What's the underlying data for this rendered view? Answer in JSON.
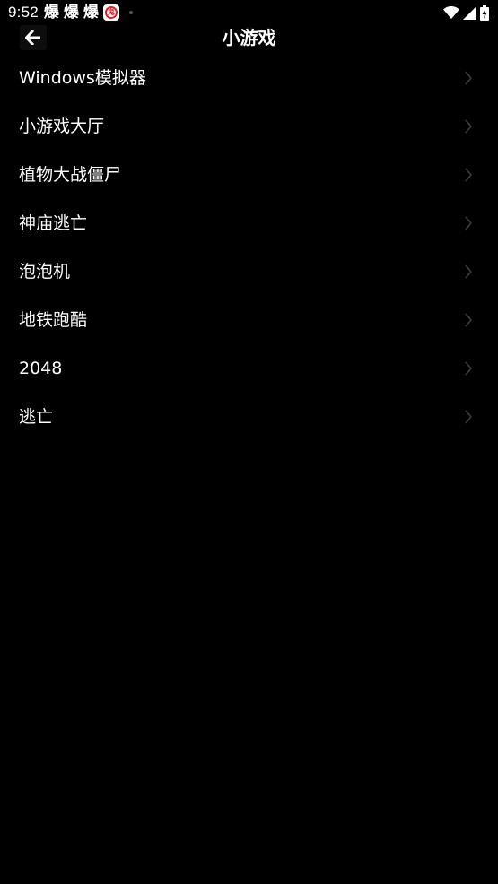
{
  "status_bar": {
    "time": "9:52",
    "notifications": [
      "爆",
      "爆",
      "爆"
    ],
    "badge_glyph": "鬼",
    "icons": [
      "wifi-icon",
      "signal-icon",
      "battery-icon"
    ]
  },
  "header": {
    "title": "小游戏",
    "back_icon": "arrow-left-icon"
  },
  "list": {
    "items": [
      {
        "label": "Windows模拟器"
      },
      {
        "label": "小游戏大厅"
      },
      {
        "label": "植物大战僵尸"
      },
      {
        "label": "神庙逃亡"
      },
      {
        "label": "泡泡机"
      },
      {
        "label": "地铁跑酷"
      },
      {
        "label": "2048"
      },
      {
        "label": "逃亡"
      }
    ],
    "chevron_icon": "chevron-right-icon"
  },
  "colors": {
    "background": "#000000",
    "text": "#ffffff",
    "chevron": "#3c3c3c",
    "badge_red": "#d9232e"
  }
}
